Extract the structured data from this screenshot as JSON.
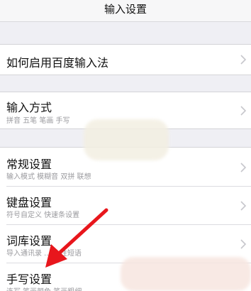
{
  "navbar": {
    "title": "输入设置"
  },
  "items": [
    {
      "label": "如何启用百度输入法",
      "sub": ""
    },
    {
      "label": "输入方式",
      "sub": "拼音 五笔 笔画 手写"
    },
    {
      "label": "常规设置",
      "sub": "输入模式 模糊音 双拼 联想"
    },
    {
      "label": "键盘设置",
      "sub": "符号自定义 快速条设置"
    },
    {
      "label": "词库设置",
      "sub": "导入通讯录 ... 个性短语"
    },
    {
      "label": "手写设置",
      "sub": "连写 笔画颜色 笔画粗细"
    }
  ],
  "icons": {
    "chevron": "chevron-right-icon",
    "arrow": "red-arrow-annotation"
  },
  "colors": {
    "background": "#efeff4",
    "arrow": "#e8161c"
  }
}
